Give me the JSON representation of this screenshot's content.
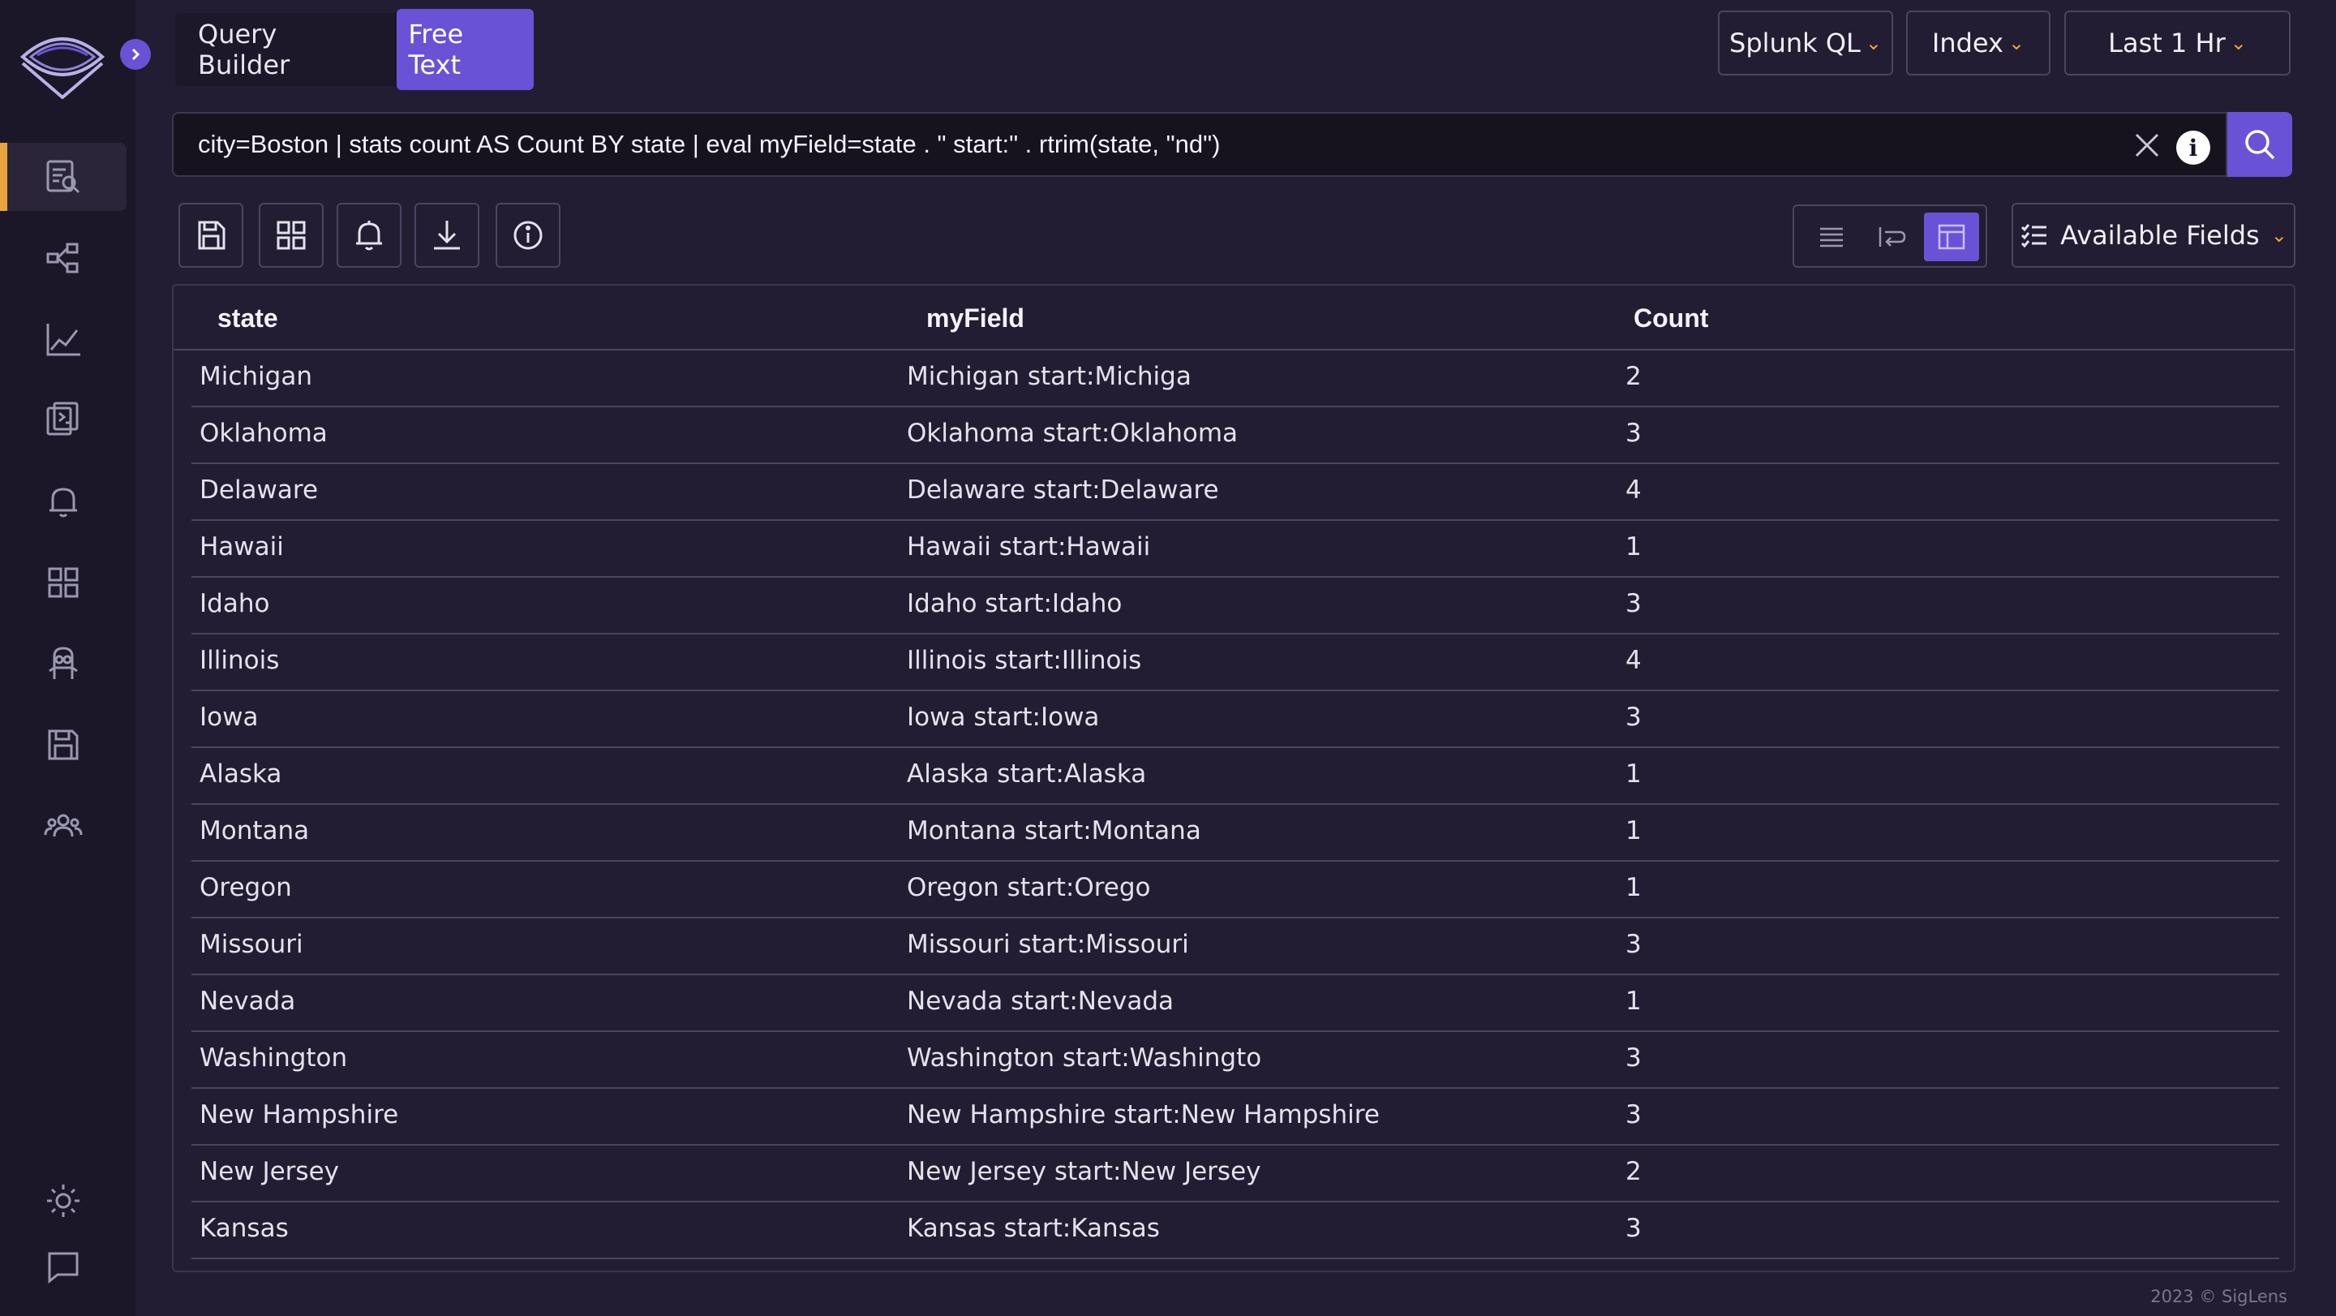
{
  "app": {
    "sidebar": {
      "items": [
        {
          "icon": "search-logs-icon",
          "active": true
        },
        {
          "icon": "service-graph-icon",
          "active": false
        },
        {
          "icon": "metrics-chart-icon",
          "active": false
        },
        {
          "icon": "live-tail-icon",
          "active": false
        },
        {
          "icon": "alerts-bell-icon",
          "active": false
        },
        {
          "icon": "dashboards-grid-icon",
          "active": false
        },
        {
          "icon": "minion-searches-icon",
          "active": false
        },
        {
          "icon": "saved-queries-icon",
          "active": false
        },
        {
          "icon": "users-icon",
          "active": false
        }
      ],
      "bottom": [
        {
          "icon": "theme-sun-icon"
        },
        {
          "icon": "feedback-chat-icon"
        }
      ],
      "expand_icon": "chevron-right-icon",
      "accent": "#e8a33d"
    },
    "mode_toggle": {
      "query_builder_label": "Query Builder",
      "free_text_label": "Free Text",
      "active": "Free Text"
    },
    "query_language": {
      "label": "Splunk QL"
    },
    "index_select": {
      "label": "Index"
    },
    "time_range": {
      "label": "Last 1 Hr"
    },
    "query": {
      "value": "city=Boston | stats count AS Count BY state | eval myField=state . \" start:\" . rtrim(state, \"nd\")"
    },
    "toolbar": {
      "buttons": [
        "save-icon",
        "dashboard-grid-icon",
        "alert-bell-icon",
        "download-icon",
        "info-circle-icon"
      ],
      "view_modes": [
        "single-line",
        "multi-line",
        "table"
      ],
      "active_view": "table",
      "available_fields_label": "Available Fields"
    },
    "table": {
      "columns": [
        "state",
        "myField",
        "Count"
      ],
      "rows": [
        [
          "Michigan",
          "Michigan start:Michiga",
          "2"
        ],
        [
          "Oklahoma",
          "Oklahoma start:Oklahoma",
          "3"
        ],
        [
          "Delaware",
          "Delaware start:Delaware",
          "4"
        ],
        [
          "Hawaii",
          "Hawaii start:Hawaii",
          "1"
        ],
        [
          "Idaho",
          "Idaho start:Idaho",
          "3"
        ],
        [
          "Illinois",
          "Illinois start:Illinois",
          "4"
        ],
        [
          "Iowa",
          "Iowa start:Iowa",
          "3"
        ],
        [
          "Alaska",
          "Alaska start:Alaska",
          "1"
        ],
        [
          "Montana",
          "Montana start:Montana",
          "1"
        ],
        [
          "Oregon",
          "Oregon start:Orego",
          "1"
        ],
        [
          "Missouri",
          "Missouri start:Missouri",
          "3"
        ],
        [
          "Nevada",
          "Nevada start:Nevada",
          "1"
        ],
        [
          "Washington",
          "Washington start:Washingto",
          "3"
        ],
        [
          "New Hampshire",
          "New Hampshire start:New Hampshire",
          "3"
        ],
        [
          "New Jersey",
          "New Jersey start:New Jersey",
          "2"
        ],
        [
          "Kansas",
          "Kansas start:Kansas",
          "3"
        ]
      ]
    },
    "footer": {
      "text": "2023 © SigLens"
    },
    "colors": {
      "background": "#221d33",
      "sidebar": "#1b1728",
      "primary": "#6a52d6",
      "accent": "#e8a33d"
    }
  }
}
